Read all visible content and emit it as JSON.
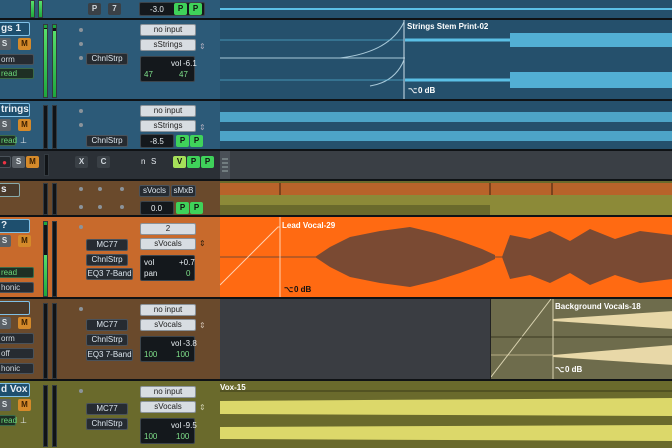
{
  "colors": {
    "blue_track": "#2c5a78",
    "blue_track_dark": "#25506c",
    "orange_track": "#c86a2c",
    "lead_clip": "#ff6a12",
    "lead_wave": "#7a4a33",
    "bg_clip": "#c9b98a",
    "olive_track": "#6a6a2c",
    "wave_blue": "#5bc0e6",
    "wave_yellow": "#dcd86a",
    "selected_name": "#7fc0e6"
  },
  "top_strip": {
    "p_button": "P",
    "seven_button": "7",
    "value": "-3.0",
    "p1": "P",
    "p2": "P"
  },
  "tracks": [
    {
      "name": "gs 1",
      "solo": "S",
      "mute": "M",
      "mode1": "orm",
      "mode2": "read",
      "input": "no input",
      "output": "sStrings",
      "insert": "ChnlStrp",
      "vol_label": "vol",
      "vol_value": "-6.1",
      "pan_left": "47",
      "pan_right": "47",
      "clip_name": "Strings Stem Print-02",
      "clip_gain": "0 dB"
    },
    {
      "name": "trings",
      "solo": "S",
      "mute": "M",
      "mode2": "read",
      "input": "no input",
      "output": "sStrings",
      "insert": "ChnlStrp",
      "vol_value": "-8.5",
      "p1": "P",
      "p2": "P"
    },
    {
      "x_label": "X",
      "c_label": "C",
      "s_label": "S",
      "m_label": "M",
      "n_label": "n",
      "s2_label": "S",
      "v_label": "V",
      "p1": "P",
      "p2": "P"
    },
    {
      "name": "s",
      "output1": "sVocls",
      "output2": "sMxB",
      "vol_value": "0.0",
      "p1": "P",
      "p2": "P"
    },
    {
      "name": "?",
      "solo": "S",
      "mute": "M",
      "mode2": "read",
      "mode3": "honic",
      "input": "2",
      "output": "sVocals",
      "insert1": "MC77",
      "insert2": "ChnlStrp",
      "insert3": "EQ3 7-Band",
      "vol_label": "vol",
      "vol_value": "+0.7",
      "pan_label": "pan",
      "pan_value": "0",
      "clip_name": "Lead Vocal-29",
      "clip_gain": "0 dB"
    },
    {
      "name": "",
      "solo": "S",
      "mute": "M",
      "mode1": "orm",
      "mode2": "off",
      "mode3": "honic",
      "input": "no input",
      "output": "sVocals",
      "insert1": "MC77",
      "insert2": "ChnlStrp",
      "insert3": "EQ3 7-Band",
      "vol_label": "vol",
      "vol_value": "-3.8",
      "pan_left": "100",
      "pan_right": "100",
      "clip_name": "Background Vocals-18",
      "clip_gain": "0 dB"
    },
    {
      "name": "d Vox",
      "solo": "S",
      "mute": "M",
      "mode2": "read",
      "input": "no input",
      "output": "sVocals",
      "insert1": "MC77",
      "insert2": "ChnlStrp",
      "vol_label": "vol",
      "vol_value": "-9.5",
      "pan_left": "100",
      "pan_right": "100",
      "clip_name": "Vox-15"
    }
  ],
  "meters": {
    "strings_level": 0.95,
    "lead_level": 0.55,
    "bg_level": 0.0,
    "vox_level": 0.0
  },
  "icons": {
    "fader": "fader-icon",
    "pan_arrows": "pan-arrows-icon",
    "gain": "clip-gain-icon"
  }
}
